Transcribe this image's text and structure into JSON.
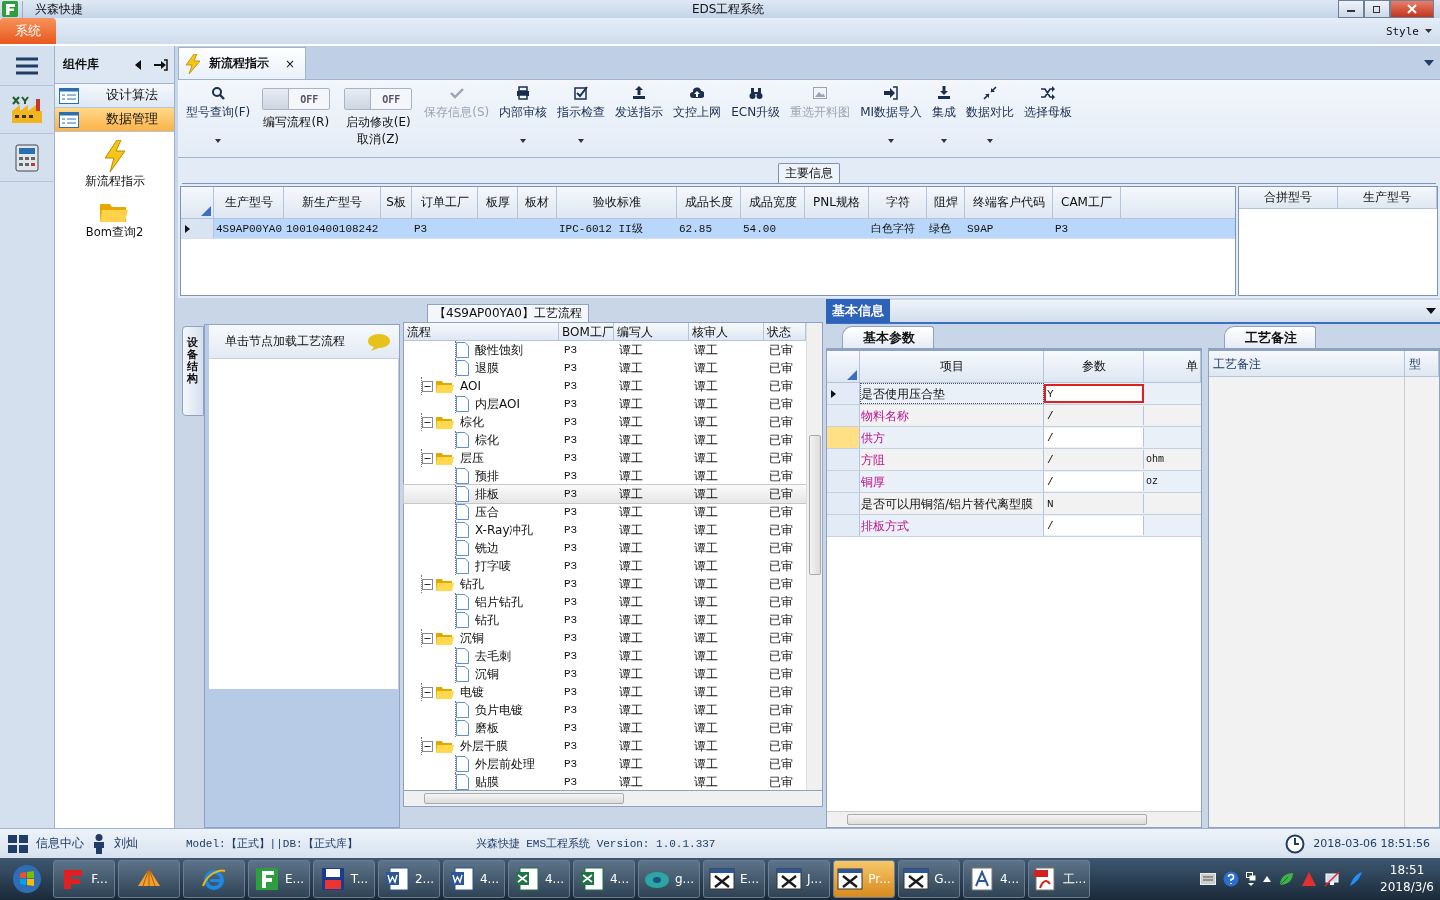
{
  "window": {
    "app_name": "兴森快捷",
    "title": "EDS工程系统"
  },
  "menu": {
    "system_tab": "系统",
    "style_menu": "Style"
  },
  "sidebar": {
    "title": "组件库",
    "items": [
      {
        "label": "设计算法",
        "selected": false
      },
      {
        "label": "数据管理",
        "selected": true
      }
    ],
    "launchers": [
      {
        "label": "新流程指示",
        "kind": "lightning"
      },
      {
        "label": "Bom查询2",
        "kind": "folder"
      }
    ]
  },
  "doc_tab": {
    "label": "新流程指示",
    "close": "×"
  },
  "toolbar": [
    {
      "kind": "button",
      "label": "型号查询(F)",
      "disabled": false,
      "dropdown": true
    },
    {
      "kind": "toggle",
      "label": "编写流程(R)",
      "state_text": "OFF",
      "on": false
    },
    {
      "kind": "toggle",
      "label": "启动修改(E)",
      "label_2": "取消(Z)",
      "state_text": "OFF",
      "on": false
    },
    {
      "kind": "button",
      "label": "保存信息(S)",
      "disabled": true,
      "dropdown": false
    },
    {
      "kind": "button",
      "label": "内部审核",
      "disabled": false,
      "dropdown": true
    },
    {
      "kind": "button",
      "label": "指示检查",
      "disabled": false,
      "dropdown": true
    },
    {
      "kind": "button",
      "label": "发送指示",
      "disabled": false,
      "dropdown": false
    },
    {
      "kind": "button",
      "label": "文控上网",
      "disabled": false,
      "dropdown": false
    },
    {
      "kind": "button",
      "label": "ECN升级",
      "disabled": false,
      "dropdown": false
    },
    {
      "kind": "button",
      "label": "重选开料图",
      "disabled": true,
      "dropdown": false
    },
    {
      "kind": "button",
      "label": "MI数据导入",
      "disabled": false,
      "dropdown": true
    },
    {
      "kind": "button",
      "label": "集成",
      "disabled": false,
      "dropdown": true
    },
    {
      "kind": "button",
      "label": "数据对比",
      "disabled": false,
      "dropdown": true
    },
    {
      "kind": "button",
      "label": "选择母板",
      "disabled": false,
      "dropdown": false
    }
  ],
  "main_info": {
    "legend": "主要信息",
    "columns": [
      "生产型号",
      "新生产型号",
      "S板",
      "订单工厂",
      "板厚",
      "板材",
      "验收标准",
      "成品长度",
      "成品宽度",
      "PNL规格",
      "字符",
      "阻焊",
      "终端客户代码",
      "CAM工厂"
    ],
    "rows": [
      {
        "selected": true,
        "cells": [
          "4S9AP00YA0",
          "10010400108242",
          null,
          "P3",
          null,
          null,
          "IPC-6012 II级",
          "62.85",
          "54.00",
          null,
          "白色字符",
          "绿色",
          "S9AP",
          "P3"
        ]
      }
    ],
    "side_columns": [
      "合拼型号",
      "生产型号"
    ]
  },
  "equipment": {
    "vertical_tab": "设备结构",
    "hint": "单击节点加载工艺流程"
  },
  "process": {
    "title": "【4S9AP00YA0】工艺流程",
    "columns": [
      "流程",
      "BOM工厂",
      "编写人",
      "核审人",
      "状态"
    ],
    "tree": [
      {
        "kind": "continued",
        "children": [
          {
            "kind": "step",
            "label": "酸性蚀刻",
            "bom": "P3",
            "writer": "谭工",
            "reviewer": "谭工",
            "status": "已审",
            "selected": false
          },
          {
            "kind": "step",
            "label": "退膜",
            "bom": "P3",
            "writer": "谭工",
            "reviewer": "谭工",
            "status": "已审",
            "selected": false
          }
        ]
      },
      {
        "kind": "folder",
        "label": "AOI",
        "expanded": true,
        "bom": "P3",
        "writer": "谭工",
        "reviewer": "谭工",
        "status": "已审",
        "selected": false,
        "children": [
          {
            "kind": "step",
            "label": "内层AOI",
            "bom": "P3",
            "writer": "谭工",
            "reviewer": "谭工",
            "status": "已审",
            "selected": false
          }
        ]
      },
      {
        "kind": "folder",
        "label": "棕化",
        "expanded": true,
        "bom": "P3",
        "writer": "谭工",
        "reviewer": "谭工",
        "status": "已审",
        "selected": false,
        "children": [
          {
            "kind": "step",
            "label": "棕化",
            "bom": "P3",
            "writer": "谭工",
            "reviewer": "谭工",
            "status": "已审",
            "selected": false
          }
        ]
      },
      {
        "kind": "folder",
        "label": "层压",
        "expanded": true,
        "bom": "P3",
        "writer": "谭工",
        "reviewer": "谭工",
        "status": "已审",
        "selected": false,
        "children": [
          {
            "kind": "step",
            "label": "预排",
            "bom": "P3",
            "writer": "谭工",
            "reviewer": "谭工",
            "status": "已审",
            "selected": false
          },
          {
            "kind": "step",
            "label": "排板",
            "bom": "P3",
            "writer": "谭工",
            "reviewer": "谭工",
            "status": "已审",
            "selected": true
          },
          {
            "kind": "step",
            "label": "压合",
            "bom": "P3",
            "writer": "谭工",
            "reviewer": "谭工",
            "status": "已审",
            "selected": false
          },
          {
            "kind": "step",
            "label": "X-Ray冲孔",
            "bom": "P3",
            "writer": "谭工",
            "reviewer": "谭工",
            "status": "已审",
            "selected": false
          },
          {
            "kind": "step",
            "label": "铣边",
            "bom": "P3",
            "writer": "谭工",
            "reviewer": "谭工",
            "status": "已审",
            "selected": false
          },
          {
            "kind": "step",
            "label": "打字唛",
            "bom": "P3",
            "writer": "谭工",
            "reviewer": "谭工",
            "status": "已审",
            "selected": false
          }
        ]
      },
      {
        "kind": "folder",
        "label": "钻孔",
        "expanded": true,
        "bom": "P3",
        "writer": "谭工",
        "reviewer": "谭工",
        "status": "已审",
        "selected": false,
        "children": [
          {
            "kind": "step",
            "label": "铝片钻孔",
            "bom": "P3",
            "writer": "谭工",
            "reviewer": "谭工",
            "status": "已审",
            "selected": false
          },
          {
            "kind": "step",
            "label": "钻孔",
            "bom": "P3",
            "writer": "谭工",
            "reviewer": "谭工",
            "status": "已审",
            "selected": false
          }
        ]
      },
      {
        "kind": "folder",
        "label": "沉铜",
        "expanded": true,
        "bom": "P3",
        "writer": "谭工",
        "reviewer": "谭工",
        "status": "已审",
        "selected": false,
        "children": [
          {
            "kind": "step",
            "label": "去毛刺",
            "bom": "P3",
            "writer": "谭工",
            "reviewer": "谭工",
            "status": "已审",
            "selected": false
          },
          {
            "kind": "step",
            "label": "沉铜",
            "bom": "P3",
            "writer": "谭工",
            "reviewer": "谭工",
            "status": "已审",
            "selected": false
          }
        ]
      },
      {
        "kind": "folder",
        "label": "电镀",
        "expanded": true,
        "bom": "P3",
        "writer": "谭工",
        "reviewer": "谭工",
        "status": "已审",
        "selected": false,
        "children": [
          {
            "kind": "step",
            "label": "负片电镀",
            "bom": "P3",
            "writer": "谭工",
            "reviewer": "谭工",
            "status": "已审",
            "selected": false
          },
          {
            "kind": "step",
            "label": "磨板",
            "bom": "P3",
            "writer": "谭工",
            "reviewer": "谭工",
            "status": "已审",
            "selected": false
          }
        ]
      },
      {
        "kind": "folder",
        "label": "外层干膜",
        "expanded": true,
        "bom": "P3",
        "writer": "谭工",
        "reviewer": "谭工",
        "status": "已审",
        "selected": false,
        "children": [
          {
            "kind": "step",
            "label": "外层前处理",
            "bom": "P3",
            "writer": "谭工",
            "reviewer": "谭工",
            "status": "已审",
            "selected": false
          },
          {
            "kind": "step",
            "label": "贴膜",
            "bom": "P3",
            "writer": "谭工",
            "reviewer": "谭工",
            "status": "已审",
            "selected": false
          }
        ]
      }
    ]
  },
  "basic_info": {
    "panel_tab": "基本信息",
    "sub_tab": "基本参数",
    "columns": [
      "项目",
      "参数",
      "单"
    ],
    "rows": [
      {
        "item": "是否使用压合垫",
        "value": "Y",
        "unit": null,
        "highlighted": false,
        "selected": true,
        "marked": false
      },
      {
        "item": "物料名称",
        "value": "/",
        "unit": null,
        "highlighted": true,
        "selected": false,
        "marked": false
      },
      {
        "item": "供方",
        "value": "/",
        "unit": null,
        "highlighted": true,
        "selected": false,
        "marked": true
      },
      {
        "item": "方阻",
        "value": "/",
        "unit": "ohm",
        "highlighted": true,
        "selected": false,
        "marked": false
      },
      {
        "item": "铜厚",
        "value": "/",
        "unit": "oz",
        "highlighted": true,
        "selected": false,
        "marked": false
      },
      {
        "item": "是否可以用铜箔/铝片替代离型膜",
        "value": "N",
        "unit": null,
        "highlighted": false,
        "selected": false,
        "marked": false
      },
      {
        "item": "排板方式",
        "value": "/",
        "unit": null,
        "highlighted": true,
        "selected": false,
        "marked": false
      }
    ]
  },
  "notes": {
    "sub_tab": "工艺备注",
    "columns": [
      "工艺备注",
      "型"
    ]
  },
  "status_bar": {
    "info_center": "信息中心",
    "user": "刘灿",
    "db": "Model:【正式】||DB:【正式库】",
    "version": "兴森快捷 EMS工程系统 Version: 1.0.1.337",
    "datetime": "2018-03-06 18:51:56"
  },
  "taskbar": {
    "items": [
      {
        "kind": "flash",
        "label": "F...",
        "active": false
      },
      {
        "kind": "shell",
        "active": false
      },
      {
        "kind": "ie",
        "active": false
      },
      {
        "kind": "eds",
        "label": "E...",
        "active": false
      },
      {
        "kind": "floppy",
        "label": "T...",
        "active": false
      },
      {
        "kind": "word",
        "label": "2...",
        "active": false
      },
      {
        "kind": "word",
        "label": "4...",
        "active": false
      },
      {
        "kind": "excel",
        "label": "4...",
        "active": false
      },
      {
        "kind": "excel",
        "label": "4...",
        "active": false
      },
      {
        "kind": "disc",
        "label": "g...",
        "active": false
      },
      {
        "kind": "xwin",
        "label": "E...",
        "active": false
      },
      {
        "kind": "xwin",
        "label": "J...",
        "active": false
      },
      {
        "kind": "xwin",
        "label": "Pr...",
        "active": true
      },
      {
        "kind": "xwin",
        "label": "G...",
        "active": false
      },
      {
        "kind": "font",
        "label": "4...",
        "active": false
      },
      {
        "kind": "pdf",
        "label": "工...",
        "active": false
      }
    ],
    "time": "18:51",
    "date": "2018/3/6"
  }
}
